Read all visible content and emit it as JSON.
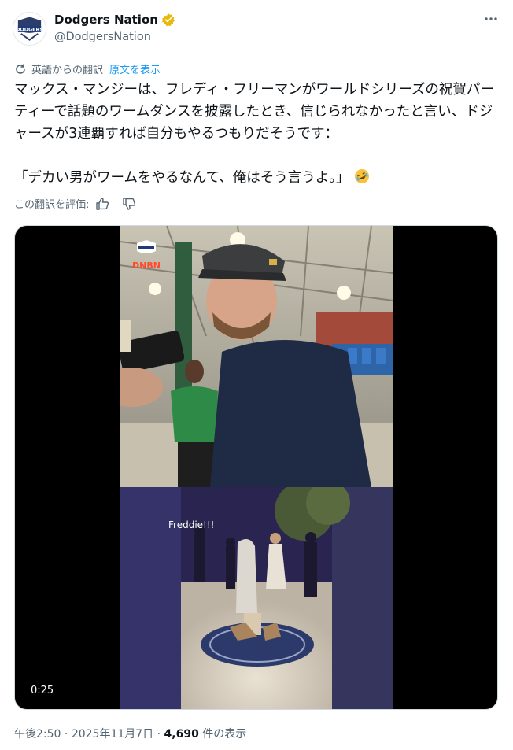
{
  "author": {
    "display_name": "Dodgers Nation",
    "handle": "@DodgersNation",
    "avatar_text": "DODGERS"
  },
  "translation": {
    "label": "英語からの翻訳",
    "show_original": "原文を表示"
  },
  "tweet": {
    "paragraph1": "マックス・マンジーは、フレディ・フリーマンがワールドシリーズの祝賀パーティーで話題のワームダンスを披露したとき、信じられなかったと言い、ドジャースが3連覇すれば自分もやるつもりだそうです：",
    "paragraph2": "「デカい男がワームをやるなんて、俺はそう言うよ。」"
  },
  "rate": {
    "label": "この翻訳を評価:"
  },
  "media": {
    "duration": "0:25",
    "overlay_caption": "Freddie!!!",
    "watermark": "DNBN"
  },
  "footer": {
    "time": "午後2:50",
    "date": "2025年11月7日",
    "views": "4,690",
    "views_suffix": "件の表示",
    "sep": " · "
  }
}
